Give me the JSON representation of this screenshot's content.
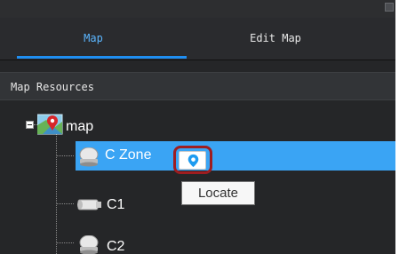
{
  "tabs": {
    "map_label": "Map",
    "edit_map_label": "Edit Map"
  },
  "section": {
    "title": "Map Resources"
  },
  "tree": {
    "root": {
      "label": "map"
    },
    "items": [
      {
        "label": "C Zone",
        "selected": true,
        "icon": "dome-camera-icon"
      },
      {
        "label": "C1",
        "selected": false,
        "icon": "bullet-camera-icon"
      },
      {
        "label": "C2",
        "selected": false,
        "icon": "dome-camera-icon"
      }
    ]
  },
  "tooltip": {
    "text": "Locate"
  },
  "colors": {
    "accent": "#1f8ef1",
    "selection": "#3aa4f4",
    "highlight_ring": "#9e1d20",
    "panel_bg": "#252628"
  }
}
